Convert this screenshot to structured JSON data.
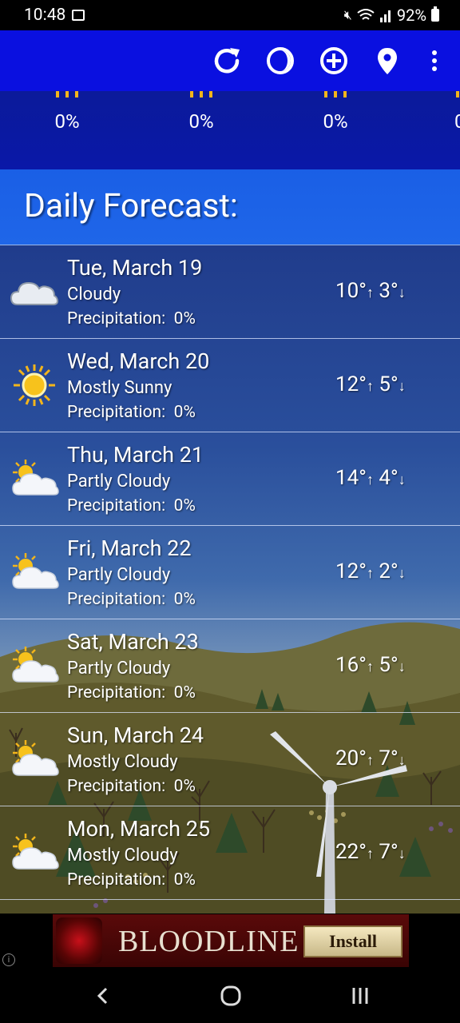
{
  "status_bar": {
    "time": "10:48",
    "battery": "92%"
  },
  "toolbar": {
    "icons": [
      "refresh-icon",
      "theme-icon",
      "add-location-icon",
      "location-pin-icon",
      "more-vert-icon"
    ]
  },
  "hourly": [
    {
      "precip": "0%"
    },
    {
      "precip": "0%"
    },
    {
      "precip": "0%"
    },
    {
      "precip": "0"
    }
  ],
  "daily_header": {
    "title": "Daily Forecast:"
  },
  "days": [
    {
      "date": "Tue, March 19",
      "condition": "Cloudy",
      "precip_label": "Precipitation:",
      "precip": "0%",
      "high": "10°",
      "low": "3°",
      "icon": "cloud-icon"
    },
    {
      "date": "Wed, March 20",
      "condition": "Mostly Sunny",
      "precip_label": "Precipitation:",
      "precip": "0%",
      "high": "12°",
      "low": "5°",
      "icon": "sun-icon"
    },
    {
      "date": "Thu, March 21",
      "condition": "Partly Cloudy",
      "precip_label": "Precipitation:",
      "precip": "0%",
      "high": "14°",
      "low": "4°",
      "icon": "partly-cloudy-icon"
    },
    {
      "date": "Fri, March 22",
      "condition": "Partly Cloudy",
      "precip_label": "Precipitation:",
      "precip": "0%",
      "high": "12°",
      "low": "2°",
      "icon": "partly-cloudy-icon"
    },
    {
      "date": "Sat, March 23",
      "condition": "Partly Cloudy",
      "precip_label": "Precipitation:",
      "precip": "0%",
      "high": "16°",
      "low": "5°",
      "icon": "partly-cloudy-icon"
    },
    {
      "date": "Sun, March 24",
      "condition": "Mostly Cloudy",
      "precip_label": "Precipitation:",
      "precip": "0%",
      "high": "20°",
      "low": "7°",
      "icon": "partly-cloudy-icon"
    },
    {
      "date": "Mon, March 25",
      "condition": "Mostly Cloudy",
      "precip_label": "Precipitation:",
      "precip": "0%",
      "high": "22°",
      "low": "7°",
      "icon": "partly-cloudy-icon"
    }
  ],
  "ad": {
    "title": "BLOODLINE",
    "install_label": "Install",
    "info": "i"
  },
  "nav": {
    "back": "‹",
    "home": "○",
    "recents": "|||"
  },
  "colors": {
    "toolbar": "#0a10e0",
    "header": "#1f66e8",
    "sun": "#f3b51b"
  }
}
